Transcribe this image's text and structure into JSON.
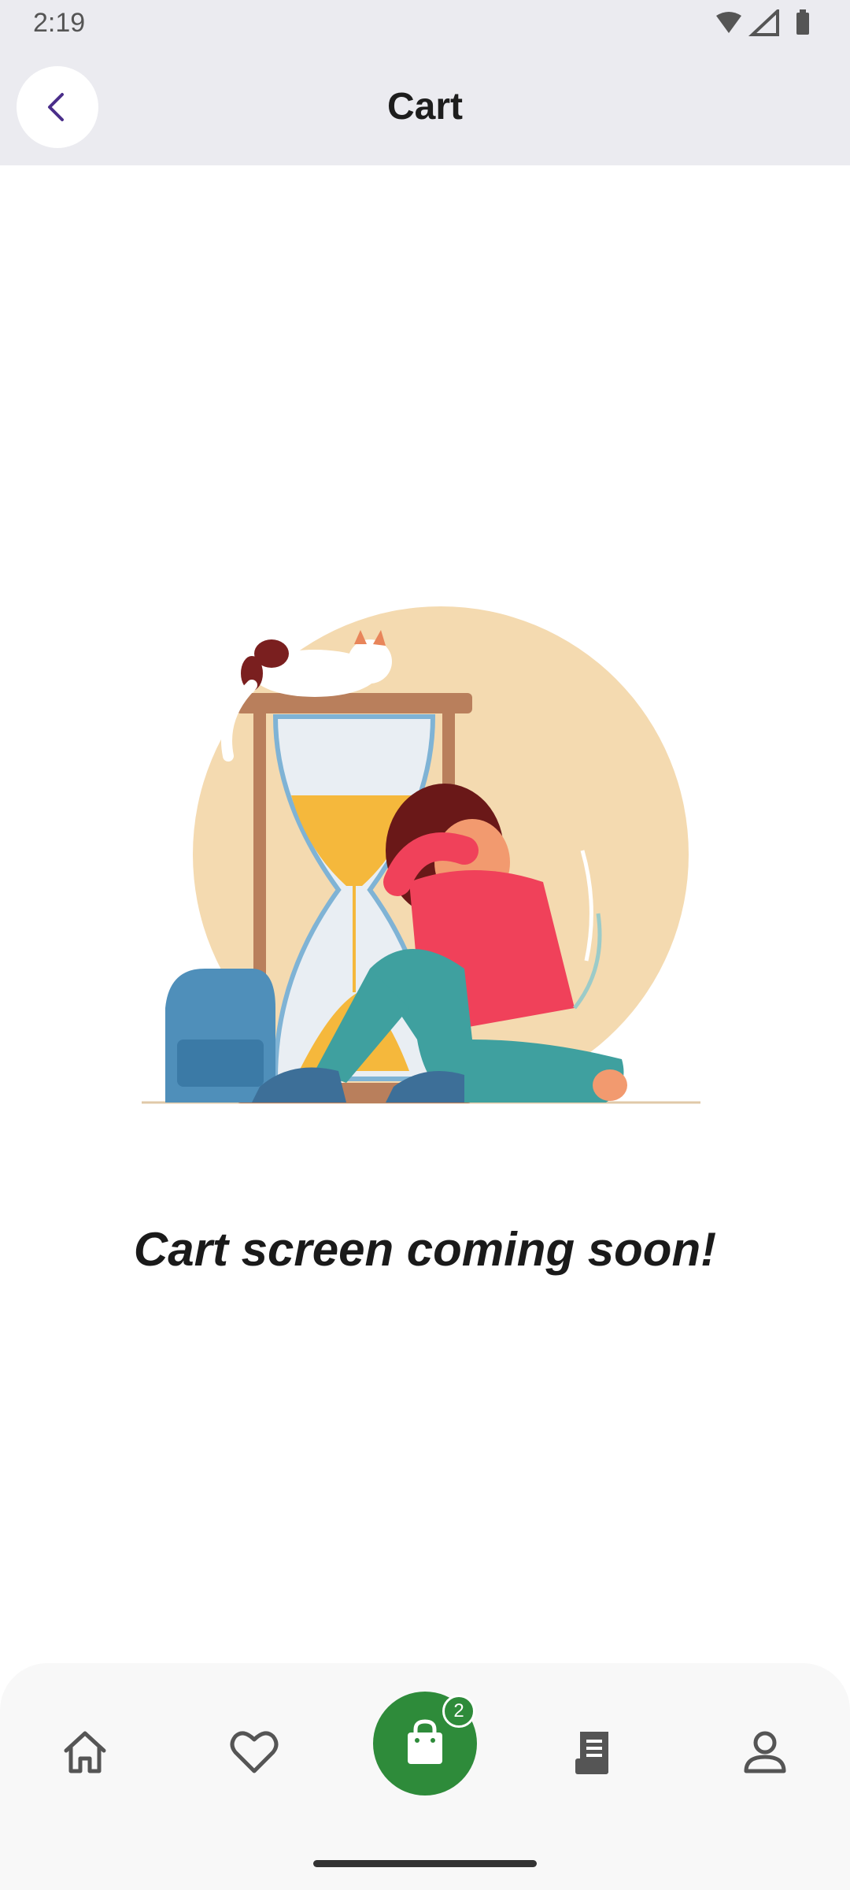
{
  "status_bar": {
    "time": "2:19",
    "icons": [
      "wifi-icon",
      "signal-icon",
      "battery-icon"
    ]
  },
  "app_bar": {
    "title": "Cart",
    "back_icon": "chevron-left-icon"
  },
  "main": {
    "illustration": "person-waiting-hourglass-illustration",
    "message": "Cart screen coming soon!"
  },
  "bottom_nav": {
    "items": [
      {
        "icon": "home-icon"
      },
      {
        "icon": "heart-icon"
      },
      {
        "icon": "shopping-bag-icon",
        "active": true
      },
      {
        "icon": "receipt-icon"
      },
      {
        "icon": "person-icon"
      }
    ],
    "cart_badge": "2"
  },
  "colors": {
    "accent_green": "#2e8b3a",
    "back_chevron": "#4a2e8a",
    "header_bg": "#ebebf0"
  }
}
